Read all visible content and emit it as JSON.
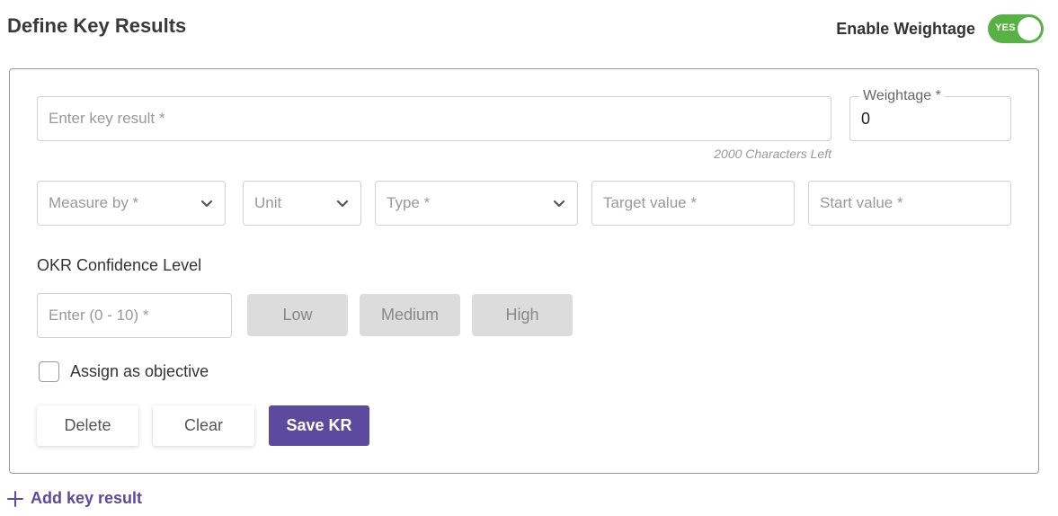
{
  "header": {
    "title": "Define Key Results",
    "weightage_toggle_label": "Enable Weightage",
    "toggle_state_text": "YES",
    "toggle_color": "#58b145"
  },
  "key_result": {
    "placeholder": "Enter key result *",
    "chars_left": "2000 Characters Left"
  },
  "weightage": {
    "label": "Weightage *",
    "value": "0"
  },
  "fields": {
    "measure_by": "Measure by *",
    "unit": "Unit",
    "type": "Type *",
    "target_value": "Target value *",
    "start_value": "Start value *"
  },
  "confidence": {
    "title": "OKR Confidence Level",
    "placeholder": "Enter (0 - 10) *",
    "levels": [
      "Low",
      "Medium",
      "High"
    ]
  },
  "assign": {
    "label": "Assign as objective",
    "checked": false
  },
  "actions": {
    "delete": "Delete",
    "clear": "Clear",
    "save": "Save KR",
    "save_color": "#5b4a9e"
  },
  "footer": {
    "add_key_result": "Add key result"
  },
  "icons": [
    "chevron-down-icon",
    "plus-icon"
  ]
}
